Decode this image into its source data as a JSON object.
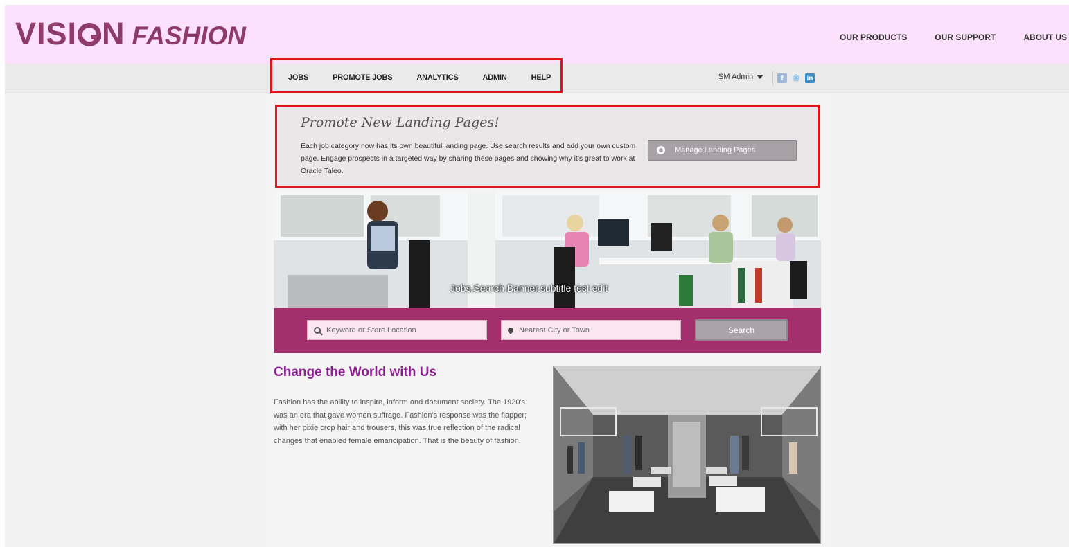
{
  "brand": {
    "logo_part1": "VISI",
    "logo_part2": "N",
    "logo_part3": "FASHION"
  },
  "top_nav": [
    "OUR PRODUCTS",
    "OUR SUPPORT",
    "ABOUT US"
  ],
  "main_nav": [
    "JOBS",
    "PROMOTE JOBS",
    "ANALYTICS",
    "ADMIN",
    "HELP"
  ],
  "user": {
    "name": "SM Admin"
  },
  "social": [
    "f",
    "t",
    "in"
  ],
  "promo": {
    "title": "Promote New Landing Pages!",
    "text": "Each job category now has its own beautiful landing page. Use search results and add your own custom page. Engage prospects in a targeted way by sharing these pages and showing why it's great to work at Oracle Taleo.",
    "button": "Manage Landing Pages"
  },
  "banner": {
    "caption": "Jobs.Search.Banner.subtitle test edit"
  },
  "search": {
    "keyword_placeholder": "Keyword or Store Location",
    "location_placeholder": "Nearest City or Town",
    "button": "Search"
  },
  "content": {
    "headline": "Change the World with Us",
    "body": "Fashion has the ability to inspire, inform and document society. The 1920's was an era that gave women suffrage. Fashion's response was the flapper; with her pixie crop hair and trousers, this was true reflection of the radical changes that enabled female emancipation. That is the beauty of fashion."
  },
  "colors": {
    "accent": "#a2306c",
    "brand": "#8e3a6a",
    "highlight": "#e0151b",
    "headline": "#8a1f8f"
  }
}
